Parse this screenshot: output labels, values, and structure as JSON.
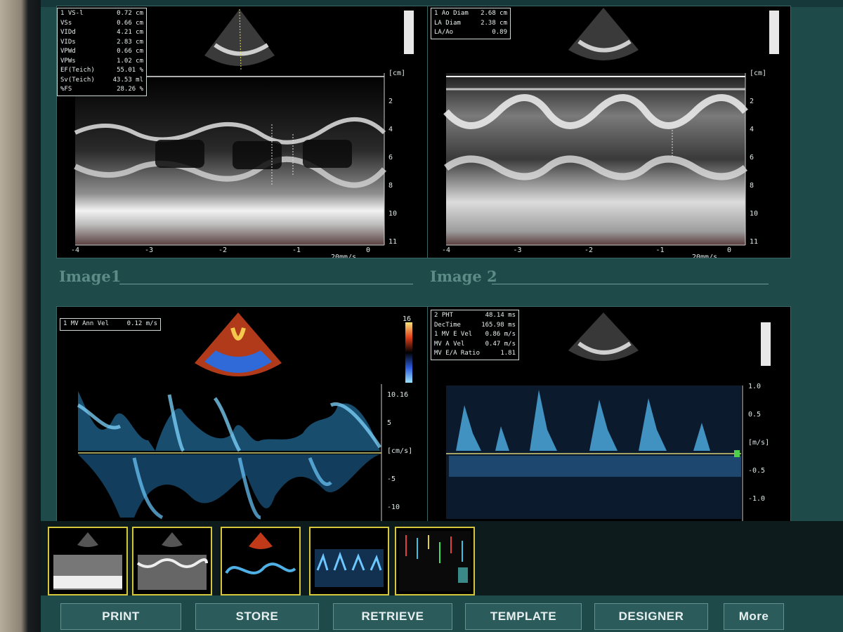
{
  "panels": {
    "top_left": {
      "caption": "Image1",
      "measurements": [
        {
          "label": "1 VS-l",
          "value": "0.72 cm"
        },
        {
          "label": "VSs",
          "value": "0.66 cm"
        },
        {
          "label": "VIDd",
          "value": "4.21 cm"
        },
        {
          "label": "VIDs",
          "value": "2.83 cm"
        },
        {
          "label": "VPWd",
          "value": "0.66 cm"
        },
        {
          "label": "VPWs",
          "value": "1.02 cm"
        },
        {
          "label": "EF(Teich)",
          "value": "55.01 %"
        },
        {
          "label": "Sv(Teich)",
          "value": "43.53 ml"
        },
        {
          "label": "%FS",
          "value": "28.26 %"
        }
      ],
      "depth_scale": [
        "[cm]",
        "2",
        "4",
        "6",
        "8",
        "10",
        "11"
      ],
      "time_scale": [
        "-4",
        "-3",
        "-2",
        "-1",
        "0"
      ],
      "sweep_label": "20mm/s"
    },
    "top_right": {
      "caption": "Image 2",
      "measurements": [
        {
          "label": "1 Ao Diam",
          "value": "2.68 cm"
        },
        {
          "label": "LA Diam",
          "value": "2.38 cm"
        },
        {
          "label": "LA/Ao",
          "value": "0.89"
        }
      ],
      "depth_scale": [
        "[cm]",
        "2",
        "4",
        "6",
        "8",
        "10",
        "11"
      ],
      "time_scale": [
        "-4",
        "-3",
        "-2",
        "-1",
        "0"
      ],
      "sweep_label": "20mm/s"
    },
    "bottom_left": {
      "measurements": [
        {
          "label": "1 MV Ann Vel",
          "value": "0.12 m/s"
        }
      ],
      "velocity_scale": [
        "10.16",
        "5",
        "[cm/s]",
        "-5",
        "-10"
      ],
      "color_bar_max": "16"
    },
    "bottom_right": {
      "measurements": [
        {
          "label": "2 PHT",
          "value": "48.14 ms"
        },
        {
          "label": "DecTime",
          "value": "165.98 ms"
        },
        {
          "label": "1 MV E Vel",
          "value": "0.86 m/s"
        },
        {
          "label": "MV A Vel",
          "value": "0.47 m/s"
        },
        {
          "label": "MV E/A Ratio",
          "value": "1.81"
        }
      ],
      "velocity_scale": [
        "1.0",
        "0.5",
        "[m/s]",
        "-0.5",
        "-1.0"
      ]
    }
  },
  "thumbnails": [
    "m-mode-lv",
    "m-mode-ao",
    "color-doppler",
    "pw-doppler",
    "report"
  ],
  "buttons": {
    "print": "PRINT",
    "store": "STORE",
    "retrieve": "RETRIEVE",
    "template": "TEMPLATE",
    "designer": "DESIGNER",
    "more": "More"
  },
  "colors": {
    "screen_bg": "#1f4a4a",
    "button_bg": "#2c5b5c",
    "thumb_border": "#d5c63c",
    "doppler_blue": "#3cb0e8",
    "baseline": "#d8d27a"
  }
}
